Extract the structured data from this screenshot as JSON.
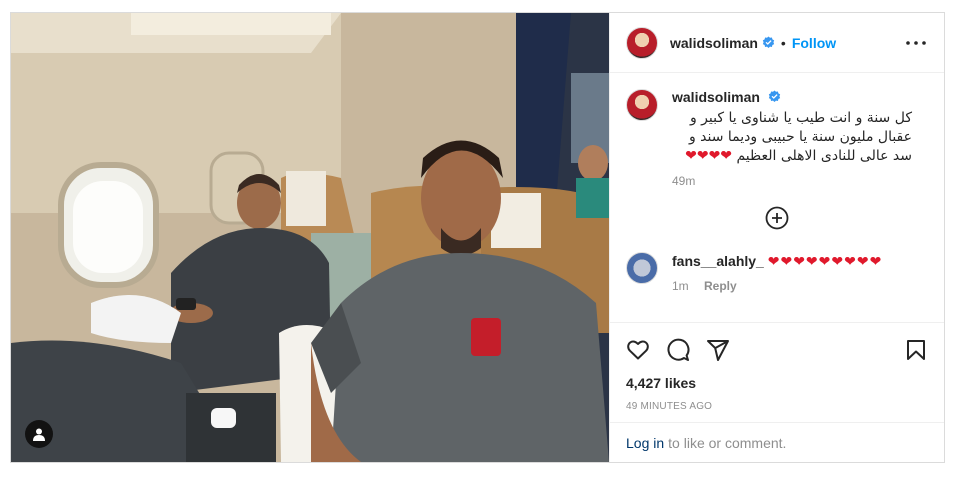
{
  "post": {
    "username": "walidsoliman",
    "dot": "•",
    "follow_label": "Follow",
    "caption_text": "كل سنة و انت طيب يا شناوى يا كبير و عقبال مليون سنة يا حبيبى وديما سند و سد عالى للنادى الاهلى العظيم",
    "caption_hearts": "❤❤❤❤",
    "caption_time": "49m",
    "reply": {
      "username": "fans__alahly_",
      "hearts": "❤❤❤❤❤❤❤❤❤",
      "time": "1m",
      "reply_label": "Reply"
    },
    "likes": "4,427 likes",
    "posted": "49 MINUTES AGO",
    "login_link": "Log in",
    "login_suffix": "to like or comment."
  },
  "icons": {
    "verified": "verified-badge-icon",
    "more": "more-options-icon",
    "load_more": "plus-circle-icon",
    "like": "heart-icon",
    "comment": "comment-icon",
    "share": "paper-plane-icon",
    "save": "bookmark-icon",
    "tag": "user-tag-icon"
  },
  "colors": {
    "accent": "#0095f6",
    "verified": "#3897f0",
    "heart": "#e0192c"
  }
}
